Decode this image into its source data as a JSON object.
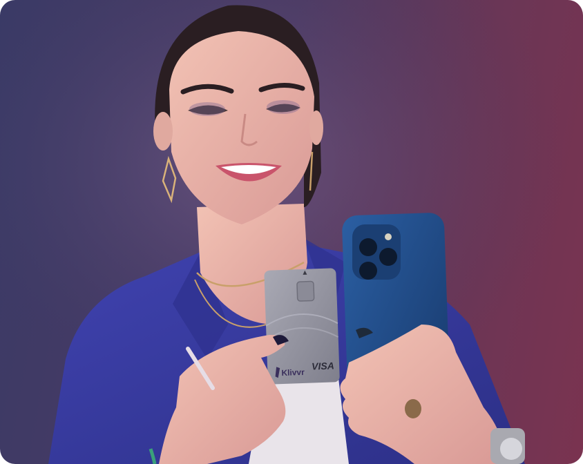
{
  "card": {
    "brand": "Klivvr",
    "network": "VISA"
  },
  "colors": {
    "background_left": "#3a3a66",
    "background_right": "#7a3350",
    "blazer": "#3b3fa6",
    "phone": "#1f4a86",
    "card": "#9a9aa6",
    "skin": "#e8b3a6",
    "hair": "#2a1e22"
  }
}
